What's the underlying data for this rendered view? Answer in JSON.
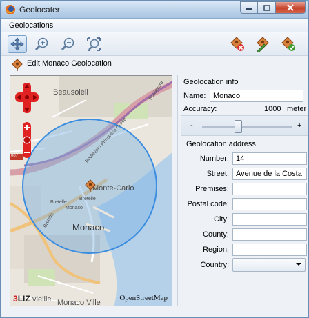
{
  "window": {
    "title": "Geolocater",
    "icons": [
      "firefox-icon"
    ],
    "buttons": [
      "minimize-button",
      "maximize-button",
      "close-button"
    ]
  },
  "menubar": {
    "items": [
      {
        "label": "Geolocations"
      }
    ]
  },
  "toolbar": {
    "left_tools": [
      "pan-tool-icon",
      "zoom-in-icon",
      "zoom-out-icon",
      "zoom-extent-icon"
    ],
    "right_tools": [
      "delete-geolocation-icon",
      "edit-geolocation-icon",
      "validate-geolocation-icon"
    ]
  },
  "editbar": {
    "title": "Edit Monaco Geolocation"
  },
  "map": {
    "labels": {
      "beausoleil": "Beausoleil",
      "monte_carlo": "Monte-Carlo",
      "monaco": "Monaco",
      "monaco_ville": "Monaco Ville",
      "bretelle_1": "Bretelle",
      "bretelle_2": "Bretelle",
      "bretelle_3": "Bretelle",
      "monaco_small": "Monaco",
      "boulevard_albert": "Boulevard Princesse Grace",
      "boulevard_2": "Boulevard",
      "road_number": "007"
    },
    "attribution": "OpenStreetMap",
    "logo_number": "3",
    "logo_text": "LIZ",
    "logo_suffix": "vieille",
    "colors": {
      "water": "#b5d0e9",
      "land": "#eae6dd",
      "circle": "#7cb3e4",
      "road": "#d79fa8"
    }
  },
  "geolocation_info": {
    "group_title": "Geolocation info",
    "name_label": "Name:",
    "name_value": "Monaco",
    "accuracy_label": "Accuracy:",
    "accuracy_value": "1000",
    "accuracy_unit": "meter",
    "slider_minus": "-",
    "slider_plus": "+"
  },
  "geolocation_address": {
    "group_title": "Geolocation address",
    "number_label": "Number:",
    "number_value": "14",
    "street_label": "Street:",
    "street_value": "Avenue de la Costa",
    "premises_label": "Premises:",
    "premises_value": "",
    "postal_label": "Postal code:",
    "postal_value": "",
    "city_label": "City:",
    "city_value": "",
    "county_label": "County:",
    "county_value": "",
    "region_label": "Region:",
    "region_value": "",
    "country_label": "Country:",
    "country_value": ""
  }
}
